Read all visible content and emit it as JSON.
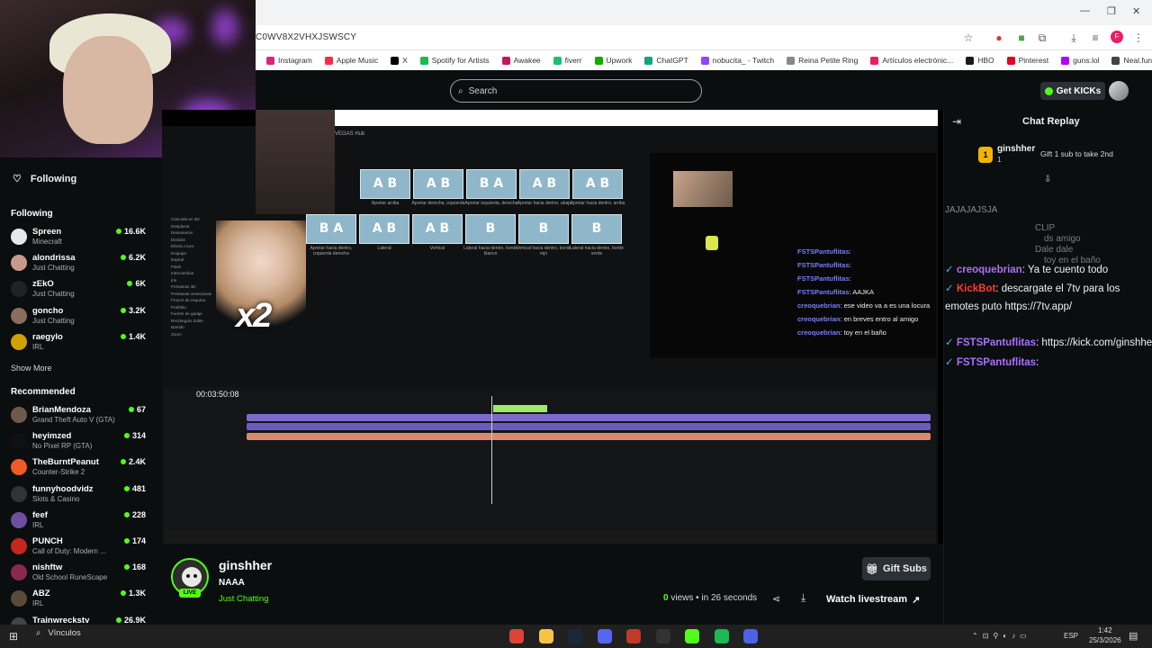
{
  "browser": {
    "url_fragment": "C0WV8X2VHXJSWSCY",
    "bookmarks": [
      "Instagram",
      "Apple Music",
      "X",
      "Spotify for Artists",
      "Awakee",
      "fiverr",
      "Upwork",
      "ChatGPT",
      "nobucita_ - Twitch",
      "Reina Petite Ring",
      "Artículos electrónic...",
      "HBO",
      "Pinterest",
      "guns.lol",
      "Neal.fun"
    ],
    "bookmark_colors": [
      "#d62976",
      "#fa2d48",
      "#000000",
      "#1db954",
      "#c2185b",
      "#1dbf73",
      "#14a800",
      "#10a37f",
      "#9146ff",
      "#888888",
      "#e91e63",
      "#1a1a1a",
      "#e60023",
      "#b000ff",
      "#444444"
    ]
  },
  "header": {
    "search_placeholder": "Search",
    "get_kicks_label": "Get KICKs"
  },
  "sidebar": {
    "following_toggle": "Following",
    "following_title": "Following",
    "following": [
      {
        "name": "Spreen",
        "category": "Minecraft",
        "viewers": "16.6K",
        "color": "#e8e8e8"
      },
      {
        "name": "alondrissa",
        "category": "Just Chatting",
        "viewers": "6.2K",
        "color": "#c49a8a"
      },
      {
        "name": "zEkO",
        "category": "Just Chatting",
        "viewers": "6K",
        "color": "#222"
      },
      {
        "name": "goncho",
        "category": "Just Chatting",
        "viewers": "3.2K",
        "color": "#8a6d5c"
      },
      {
        "name": "raegylo",
        "category": "IRL",
        "viewers": "1.4K",
        "color": "#d1a100"
      }
    ],
    "show_more": "Show More",
    "recommended_title": "Recommended",
    "recommended": [
      {
        "name": "BrianMendoza",
        "category": "Grand Theft Auto V (GTA)",
        "viewers": "67",
        "color": "#6e5a4d"
      },
      {
        "name": "heyimzed",
        "category": "No Pixel RP (GTA)",
        "viewers": "314",
        "color": "#111"
      },
      {
        "name": "TheBurntPeanut",
        "category": "Counter-Strike 2",
        "viewers": "2.4K",
        "color": "#f05a28"
      },
      {
        "name": "funnyhoodvidz",
        "category": "Slots & Casino",
        "viewers": "481",
        "color": "#333"
      },
      {
        "name": "feef",
        "category": "IRL",
        "viewers": "228",
        "color": "#6d4fa0"
      },
      {
        "name": "PUNCH",
        "category": "Call of Duty: Modern ...",
        "viewers": "174",
        "color": "#c4281c"
      },
      {
        "name": "nishftw",
        "category": "Old School RuneScape",
        "viewers": "168",
        "color": "#8a2a4a"
      },
      {
        "name": "ABZ",
        "category": "IRL",
        "viewers": "1.3K",
        "color": "#5a4a3a"
      },
      {
        "name": "Trainwreckstv",
        "category": "",
        "viewers": "26.9K",
        "color": "#444"
      }
    ]
  },
  "video": {
    "vegas_tab": "VEGAS Hub",
    "transitions": [
      {
        "label": "A B",
        "caption": "Apretar arriba"
      },
      {
        "label": "A B",
        "caption": "Apretar derecha, izquierda"
      },
      {
        "label": "B A",
        "caption": "Apretar izquierda, derecha"
      },
      {
        "label": "A B",
        "caption": "Apretar hacia dentro, abajo"
      },
      {
        "label": "A B",
        "caption": "Apretar hacia dentro, arriba"
      },
      {
        "label": "B A",
        "caption": "Apretar hacia dentro, izquierda derecha"
      },
      {
        "label": "A B",
        "caption": "Lateral"
      },
      {
        "label": "A B",
        "caption": "Vertical"
      },
      {
        "label": "B",
        "caption": "Lateral hacia dentro, borde blanco"
      },
      {
        "label": "B",
        "caption": "Vertical hacia dentro, borde rojo"
      },
      {
        "label": "B",
        "caption": "Lateral hacia dentro, borde verde"
      }
    ],
    "fx_list": [
      "Cascada en 3D",
      "Desplazar",
      "Desvanecer",
      "División",
      "Efecto cruce",
      "Empujar",
      "Espiral",
      "Flash",
      "Intercambiar",
      "Iris",
      "Persianas 3D",
      "Persianas venecianas",
      "Fruncir de esquina",
      "Portfolio",
      "Fuente de garaje",
      "Rectángulo doble",
      "Barrido",
      "Zoom"
    ],
    "timecode": "00:03:50:08",
    "overlay_chat": [
      {
        "name": "FSTSPantuflitas",
        "text": ""
      },
      {
        "name": "FSTSPantuflitas",
        "text": ""
      },
      {
        "name": "FSTSPantuflitas",
        "text": ""
      },
      {
        "name": "FSTSPantuflitas",
        "text": "AAJKA"
      },
      {
        "name": "creoquebrian",
        "text": "ese video va a es una locura"
      },
      {
        "name": "creoquebrian",
        "text": "en breves entro al amigo"
      },
      {
        "name": "creoquebrian",
        "text": "toy en el baño"
      }
    ],
    "x2_text": "x2"
  },
  "stream": {
    "streamer": "ginshher",
    "title": "NAAA",
    "category": "Just Chatting",
    "live_label": "LIVE",
    "gift_subs_label": "Gift Subs",
    "views_count": "0",
    "views_label": " views",
    "time_ago": " • in 26 seconds",
    "watch_label": "Watch livestream"
  },
  "chat": {
    "title": "Chat Replay",
    "pinned_user": "ginshher",
    "pinned_count": "1",
    "pinned_text": "Gift 1 sub to take 2nd",
    "messages": [
      {
        "name": "creoquebrian",
        "text": "Ya te cuento todo",
        "color": "#a970ff"
      },
      {
        "name": "KickBot",
        "text": "descargate el 7tv para los",
        "color": "#ff3b30"
      },
      {
        "name": "",
        "text": "emotes puto https://7tv.app/",
        "color": "#ffffff"
      },
      {
        "name": "FSTSPantuflitas",
        "text": "https://kick.com/ginshher/",
        "color": "#a970ff"
      },
      {
        "name": "FSTSPantuflitas",
        "text": "",
        "color": "#a970ff"
      }
    ],
    "faded_top": "JAJAJAJSJA",
    "faded_lines": [
      "CLIP",
      "ds amigo",
      "Dale dale",
      "toy en el baño"
    ]
  },
  "taskbar": {
    "search_label": "Vínculos",
    "language": "ESP",
    "time": "1:42",
    "date": "25/3/2026"
  }
}
